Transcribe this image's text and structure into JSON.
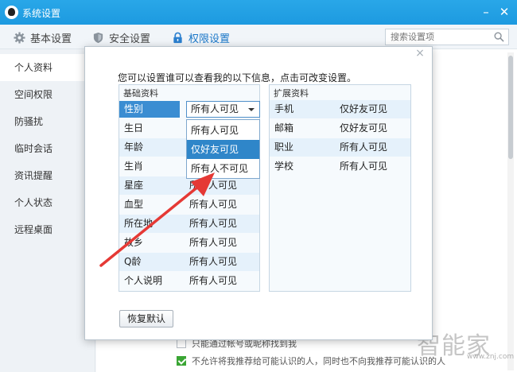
{
  "window": {
    "title": "系统设置",
    "minimize_glyph": "–",
    "close_glyph": "✕"
  },
  "toolbar": {
    "tabs": [
      {
        "label": "基本设置",
        "icon": "gear-icon"
      },
      {
        "label": "安全设置",
        "icon": "shield-icon"
      },
      {
        "label": "权限设置",
        "icon": "lock-icon"
      }
    ],
    "active_tab": "权限设置",
    "search_placeholder": "搜索设置项"
  },
  "sidebar": {
    "items": [
      "个人资料",
      "空间权限",
      "防骚扰",
      "临时会话",
      "资讯提醒",
      "个人状态",
      "远程桌面"
    ],
    "active_item": "个人资料"
  },
  "background_options": [
    {
      "label": "只能通过帐号或昵称找到我",
      "checked": false
    },
    {
      "label": "不允许将我推荐给可能认识的人，同时也不向我推荐可能认识的人",
      "checked": true
    }
  ],
  "dialog": {
    "close_glyph": "×",
    "intro": "您可以设置谁可以查看我的以下信息，点击可改变设置。",
    "basic": {
      "header": "基础资料",
      "rows": [
        {
          "key": "性别",
          "value": "所有人可见"
        },
        {
          "key": "生日",
          "value": "所有人可见"
        },
        {
          "key": "年龄",
          "value": "所有人可见"
        },
        {
          "key": "生肖",
          "value": "所有人可见"
        },
        {
          "key": "星座",
          "value": "所有人可见"
        },
        {
          "key": "血型",
          "value": "所有人可见"
        },
        {
          "key": "所在地",
          "value": "所有人可见"
        },
        {
          "key": "故乡",
          "value": "所有人可见"
        },
        {
          "key": "Q龄",
          "value": "所有人可见"
        },
        {
          "key": "个人说明",
          "value": "所有人可见"
        }
      ]
    },
    "extended": {
      "header": "扩展资料",
      "rows": [
        {
          "key": "手机",
          "value": "仅好友可见"
        },
        {
          "key": "邮箱",
          "value": "仅好友可见"
        },
        {
          "key": "职业",
          "value": "所有人可见"
        },
        {
          "key": "学校",
          "value": "所有人可见"
        }
      ]
    },
    "dropdown": {
      "selected": "所有人可见",
      "options": [
        "所有人可见",
        "仅好友可见",
        "所有人不可见"
      ],
      "highlighted": "仅好友可见"
    },
    "restore_label": "恢复默认"
  },
  "watermark": {
    "text": "智能家",
    "url": "www.znj.com"
  },
  "colors": {
    "titlebar": "#1d9ae0",
    "selection": "#3b8dd2",
    "annotation_arrow": "#e53935"
  }
}
